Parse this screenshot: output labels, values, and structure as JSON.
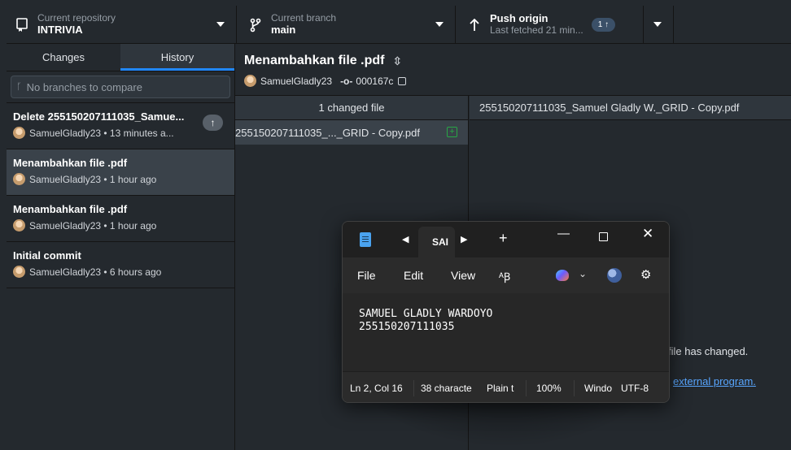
{
  "toolbar": {
    "repo": {
      "label": "Current repository",
      "value": "INTRIVIA"
    },
    "branch": {
      "label": "Current branch",
      "value": "main"
    },
    "push": {
      "label": "Push origin",
      "sub": "Last fetched 21 min...",
      "badge": "1 ↑"
    }
  },
  "sidebar": {
    "tabs": [
      {
        "label": "Changes"
      },
      {
        "label": "History"
      }
    ],
    "compare_placeholder": "No branches to compare",
    "commits": [
      {
        "title": "Delete 255150207111035_Samue...",
        "meta": "SamuelGladly23 • 13 minutes a...",
        "push_icon": "↑"
      },
      {
        "title": "Menambahkan file .pdf",
        "meta": "SamuelGladly23 • 1 hour ago"
      },
      {
        "title": "Menambahkan file .pdf",
        "meta": "SamuelGladly23 • 1 hour ago"
      },
      {
        "title": "Initial commit",
        "meta": "SamuelGladly23 • 6 hours ago"
      }
    ]
  },
  "commit_detail": {
    "title": "Menambahkan file .pdf",
    "author": "SamuelGladly23",
    "sha": "000167c",
    "changed_files_label": "1 changed file",
    "file_name": "255150207111035_..._GRID - Copy.pdf",
    "diff_file": "255150207111035_Samuel Gladly W._GRID - Copy.pdf",
    "diff_message": "file has changed.",
    "diff_link": "external program."
  },
  "notepad": {
    "tab_label": "SAI",
    "menu": {
      "file": "File",
      "edit": "Edit",
      "view": "View"
    },
    "content": "SAMUEL GLADLY WARDOYO\n255150207111035",
    "status": {
      "position": "Ln 2, Col 16",
      "chars": "38 characte",
      "format": "Plain t",
      "zoom": "100%",
      "line_ending": "Windo",
      "encoding": "UTF-8"
    }
  },
  "colors": {
    "accent": "#2188ff",
    "added": "#28a745",
    "link": "#58a6ff"
  }
}
